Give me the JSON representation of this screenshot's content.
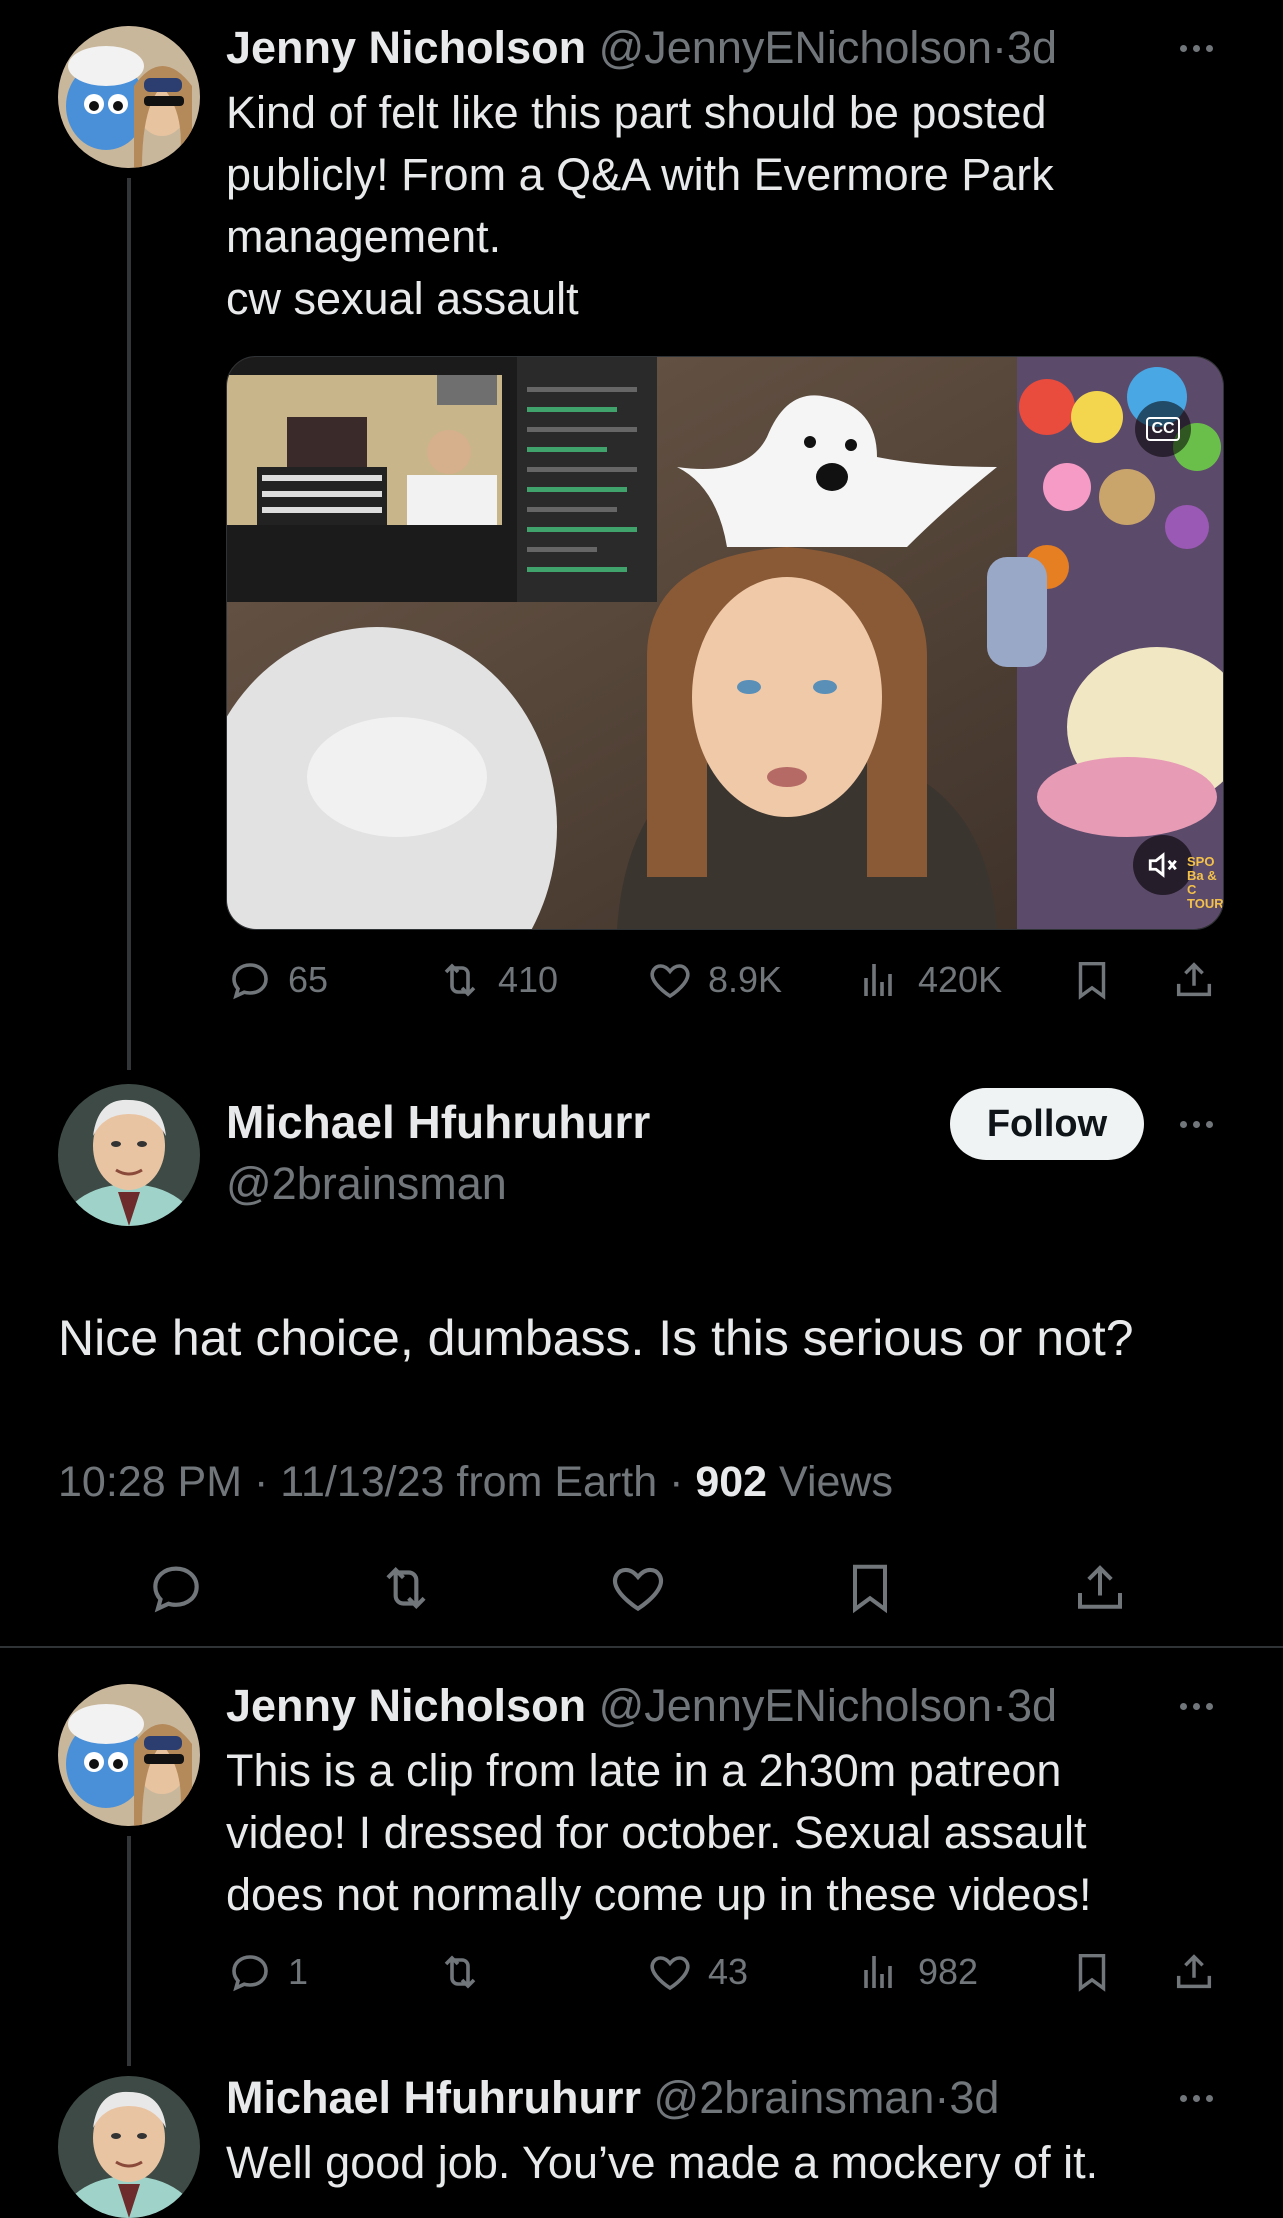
{
  "tweets": [
    {
      "name": "Jenny Nicholson",
      "handle": "@JennyENicholson",
      "time": "3d",
      "lines": [
        "Kind of felt like this part should be posted",
        "publicly! From a Q&A with Evermore Park",
        "management.",
        "cw sexual assault"
      ],
      "stats": {
        "replies": "65",
        "reposts": "410",
        "likes": "8.9K",
        "views": "420K"
      }
    },
    {
      "name": "Jenny Nicholson",
      "handle": "@JennyENicholson",
      "time": "3d",
      "lines": [
        "This is a clip from late in a 2h30m patreon",
        "video! I dressed for october. Sexual assault",
        "does not normally come up in these videos!"
      ],
      "stats": {
        "replies": "1",
        "reposts": "",
        "likes": "43",
        "views": "982"
      }
    },
    {
      "name": "Michael Hfuhruhurr",
      "handle": "@2brainsman",
      "time": "3d",
      "text": "Well good job. You’ve made a mockery of it."
    }
  ],
  "focused": {
    "name": "Michael Hfuhruhurr",
    "handle": "@2brainsman",
    "follow_label": "Follow",
    "text": "Nice hat choice, dumbass. Is this serious or not?",
    "timestamp": "10:28 PM · 11/13/23 from Earth · ",
    "views_count": "902",
    "views_label": " Views"
  },
  "media": {
    "cc_label": "CC",
    "sign_text": "SPO Ba & C TOUR"
  },
  "colors": {
    "background": "#000000",
    "text": "#e7e9ea",
    "muted": "#71767b",
    "divider": "#2f3336"
  }
}
